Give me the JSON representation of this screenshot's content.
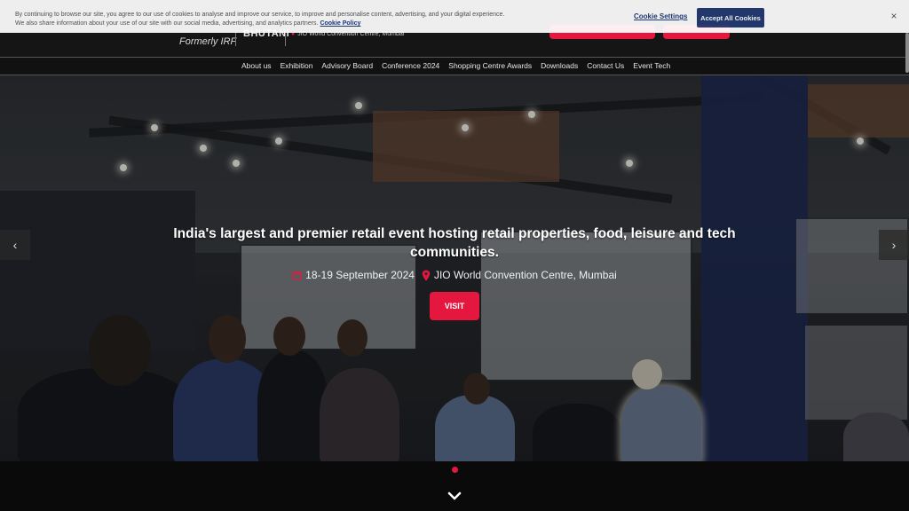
{
  "cookie_banner": {
    "text": "By continuing to browse our site, you agree to our use of cookies to analyse and improve our service, to improve and personalise content, advertising, and your digital experience. We also share information about your use of our site with our social media, advertising, and analytics partners.",
    "policy_link": "Cookie Policy",
    "settings_label": "Cookie Settings",
    "accept_label": "Accept All Cookies",
    "close_symbol": "×"
  },
  "header": {
    "logo_subtitle": "Formerly IRF",
    "partner_logo": "BHUTANI",
    "venue": "JIO World Convention Centre, Mumbai",
    "accent_color": "#e5173f"
  },
  "nav": {
    "items": [
      "About us",
      "Exhibition",
      "Advisory Board",
      "Conference 2024",
      "Shopping Centre Awards",
      "Downloads",
      "Contact Us",
      "Event Tech"
    ]
  },
  "hero": {
    "headline": "India's largest and premier retail event hosting retail properties, food, leisure and tech communities.",
    "date": "18-19 September 2024",
    "location": "JIO World Convention Centre, Mumbai",
    "cta_label": "VISIT",
    "prev_icon": "chevron-left-icon",
    "next_icon": "chevron-right-icon",
    "prev_symbol": "‹",
    "next_symbol": "›"
  }
}
